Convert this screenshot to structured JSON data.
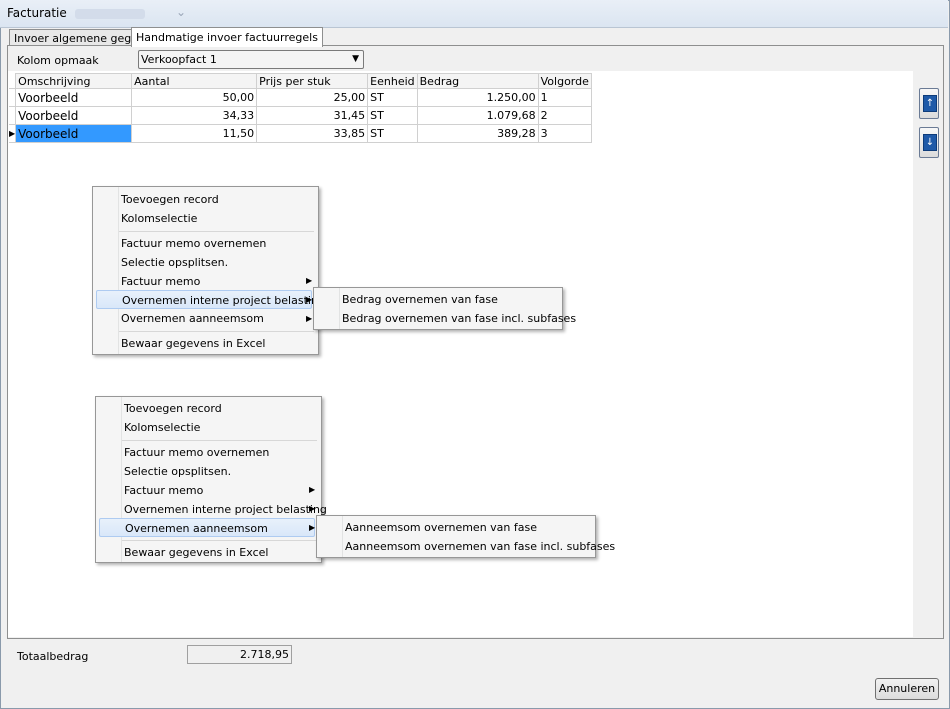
{
  "window": {
    "title": "Facturatie"
  },
  "tabs": [
    {
      "label": "Invoer algemene gegevens"
    },
    {
      "label": "Handmatige invoer factuurregels"
    }
  ],
  "kolom": {
    "label": "Kolom opmaak",
    "value": "Verkoopfact 1"
  },
  "grid": {
    "headers": [
      "Omschrijving",
      "Aantal",
      "Prijs per stuk",
      "Eenheid",
      "Bedrag",
      "Volgorde"
    ],
    "rows": [
      [
        "Voorbeeld",
        "50,00",
        "25,00",
        "ST",
        "1.250,00",
        "1"
      ],
      [
        "Voorbeeld",
        "34,33",
        "31,45",
        "ST",
        "1.079,68",
        "2"
      ],
      [
        "Voorbeeld",
        "11,50",
        "33,85",
        "ST",
        "389,28",
        "3"
      ]
    ]
  },
  "menu1": {
    "items": [
      "Toevoegen record",
      "Kolomselectie",
      "Factuur memo overnemen",
      "Selectie opsplitsen.",
      "Factuur memo",
      "Overnemen interne project belasting",
      "Overnemen aanneemsom",
      "Bewaar gegevens in Excel"
    ],
    "submenu": [
      "Bedrag overnemen van fase",
      "Bedrag overnemen van fase incl. subfases"
    ]
  },
  "menu2": {
    "items": [
      "Toevoegen record",
      "Kolomselectie",
      "Factuur memo overnemen",
      "Selectie opsplitsen.",
      "Factuur memo",
      "Overnemen interne project belasting",
      "Overnemen aanneemsom",
      "Bewaar gegevens in Excel"
    ],
    "submenu": [
      "Aanneemsom overnemen van fase",
      "Aanneemsom overnemen van fase incl. subfases"
    ]
  },
  "footer": {
    "totaal_label": "Totaalbedrag",
    "totaal_value": "2.718,95",
    "cancel_label": "Annuleren"
  },
  "colors": {
    "selection": "#3399ff",
    "menu_highlight": "#d9e7f9",
    "nav_button": "#1f5aa8"
  }
}
